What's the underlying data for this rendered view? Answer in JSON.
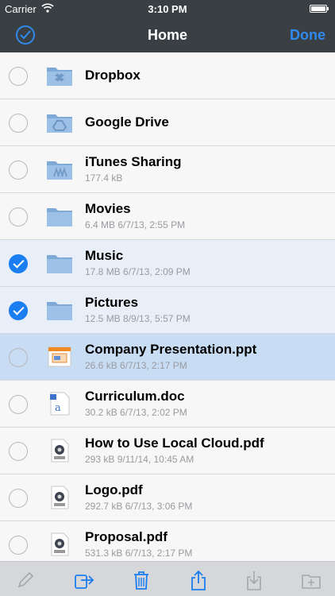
{
  "status_bar": {
    "carrier": "Carrier",
    "time": "3:10 PM"
  },
  "nav": {
    "title": "Home",
    "done_label": "Done"
  },
  "colors": {
    "accent": "#1a7df0",
    "nav_background": "#3a3f44",
    "folder": "#8fb6de",
    "meta_text": "#9a9aa0"
  },
  "files": [
    {
      "name": "Dropbox",
      "meta": "",
      "icon": "dropbox-folder-icon",
      "checked": false
    },
    {
      "name": "Google Drive",
      "meta": "",
      "icon": "google-drive-folder-icon",
      "checked": false
    },
    {
      "name": "iTunes Sharing",
      "meta": "177.4 kB",
      "icon": "itunes-sharing-folder-icon",
      "checked": false
    },
    {
      "name": "Movies",
      "meta": "6.4 MB 6/7/13, 2:55 PM",
      "icon": "folder-icon",
      "checked": false
    },
    {
      "name": "Music",
      "meta": "17.8 MB 6/7/13, 2:09 PM",
      "icon": "folder-icon",
      "checked": true
    },
    {
      "name": "Pictures",
      "meta": "12.5 MB 8/9/13, 5:57 PM",
      "icon": "folder-icon",
      "checked": true
    },
    {
      "name": "Company Presentation.ppt",
      "meta": "26.6 kB 6/7/13, 2:17 PM",
      "icon": "ppt-file-icon",
      "checked": false
    },
    {
      "name": "Curriculum.doc",
      "meta": "30.2 kB 6/7/13, 2:02 PM",
      "icon": "doc-file-icon",
      "checked": false
    },
    {
      "name": "How to Use Local Cloud.pdf",
      "meta": "293 kB 9/11/14, 10:45 AM",
      "icon": "pdf-file-icon",
      "checked": false
    },
    {
      "name": "Logo.pdf",
      "meta": "292.7 kB 6/7/13, 3:06 PM",
      "icon": "pdf-file-icon",
      "checked": false
    },
    {
      "name": "Proposal.pdf",
      "meta": "531.3 kB 6/7/13, 2:17 PM",
      "icon": "pdf-file-icon",
      "checked": false
    }
  ],
  "toolbar": {
    "items": [
      {
        "icon": "pencil-icon",
        "enabled": false
      },
      {
        "icon": "move-icon",
        "enabled": true
      },
      {
        "icon": "trash-icon",
        "enabled": true
      },
      {
        "icon": "share-icon",
        "enabled": true
      },
      {
        "icon": "download-icon",
        "enabled": false
      },
      {
        "icon": "new-folder-icon",
        "enabled": false
      }
    ]
  }
}
